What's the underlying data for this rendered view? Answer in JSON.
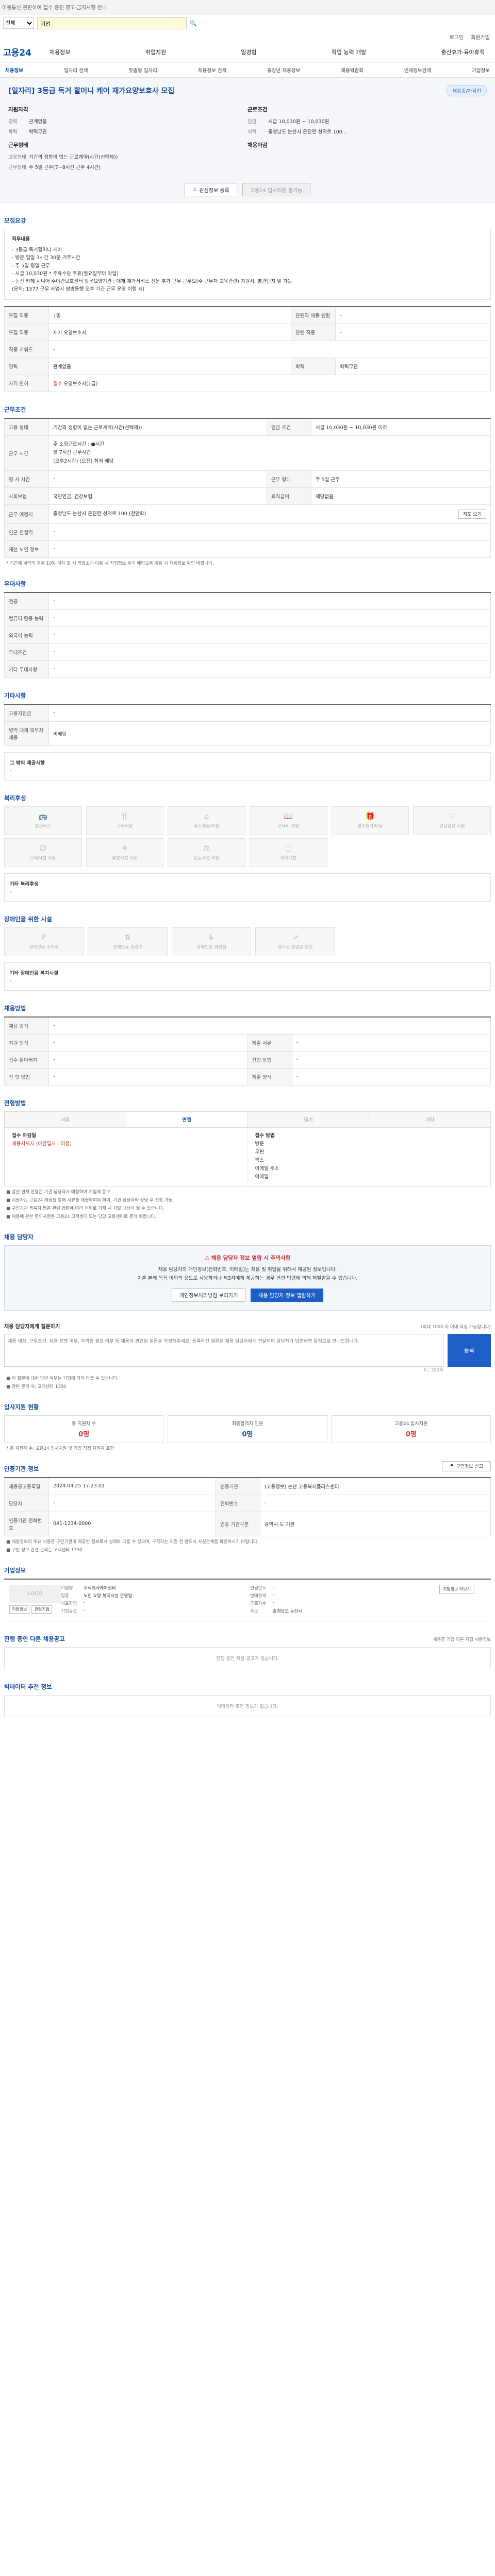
{
  "top": {
    "skip_text": "이동통신 관련하여 접수 중인 광고·금지사항 안내"
  },
  "search": {
    "category": "전체",
    "placeholder": "기업"
  },
  "util": [
    "로그인",
    "회원가입"
  ],
  "logo": "고용24",
  "gnb": [
    "채용정보",
    "취업지원",
    "일경험",
    "직업 능력 개발",
    "출산휴가·육아휴직"
  ],
  "subnav": [
    "채용정보",
    "일자리 검색",
    "맞춤형 일자리",
    "채용정보 검색",
    "중장년 채용정보",
    "채용박람회",
    "인재정보검색",
    "기업정보"
  ],
  "hero": {
    "title": "[일자리] 3등급 독거 할머니 케어 재가요양보호사 모집",
    "badge": "채용중/마감전",
    "company_head": "지원자격",
    "company_rows": [
      {
        "k": "경력",
        "v": "관계없음"
      },
      {
        "k": "학력",
        "v": "학력무관"
      }
    ],
    "cond_head": "근로조건",
    "cond_rows": [
      {
        "k": "임금",
        "v": "시급 10,030원 ~ 10,030원"
      },
      {
        "k": "지역",
        "v": "충청남도 논산시 은진면 성덕로 100..."
      }
    ],
    "place_head": "근무형태",
    "place_rows": [
      {
        "k": "고용형태",
        "v": "기간의 정함이 없는 근로계약(시간(선택제))"
      },
      {
        "k": "근무형태",
        "v": "주 5일 근무(7~8시간 근무 4시간)"
      }
    ],
    "intake_head": "채용마감",
    "btn_share": "관심정보 등록",
    "btn_apply": "고용24 입사지원 불가능"
  },
  "recruit": {
    "title": "모집요강",
    "desc_title": "직무내용",
    "desc_lines": [
      "- 3등급 독거할머니 케어",
      "- 방문 일일 3시간 30분 거주시간",
      "- 주 5일 평일 근무",
      "- 시급 10,030원 * 주휴수당 주휴(월요일부터 작업)",
      "- 논산 카페 시니어 주야간보호센터 방문요양기관 : 대개 재가서비스 전문 추가 근무 근무요(주 근무자 교육관련) 지원시, 별관단지 앞 가능",
      "  (문의: 1577 근무 사업시 쌍방통행 오후 기관 근무 운영 이행 시)"
    ],
    "rows": [
      {
        "k1": "모집 직종",
        "v1": "1명",
        "k2": "관련직 채용 인원",
        "v2": "-"
      },
      {
        "k1": "모집 직종",
        "v1": "재가 요양보호사",
        "k2": "관련 직종",
        "v2": "-"
      },
      {
        "k1": "직종 키워드",
        "v1": "-",
        "k2": "",
        "v2": ""
      },
      {
        "k1": "경력",
        "v1": "관계없음",
        "k2": "학력",
        "v2": "학력무관"
      },
      {
        "k1": "자격 면허",
        "v1": "필수",
        "v1b": "요양보호사(1급)",
        "k2": "",
        "v2": ""
      }
    ]
  },
  "workcond": {
    "title": "근무조건",
    "rows": [
      {
        "k1": "고용 형태",
        "v1": "기간의 정함이 없는 근로계약(시간(선택제))",
        "k2": "임금 조건",
        "v2": "시급 10,030원 ~ 10,030원 이하"
      },
      {
        "k1": "근무 시간",
        "v1": "주 소정근로시간 : ●시간\n평 7시간 근무시간\n(오후2시간) (오전) 최저 해당",
        "k2": "",
        "v2": ""
      },
      {
        "k1": "평 사 시간",
        "v1": "-",
        "k2": "근무 형태",
        "v2": "주 5일 근무"
      },
      {
        "k1": "사회보험",
        "v1": "국민연금, 건강보험",
        "k2": "퇴직급여",
        "v2": "해당없음"
      },
      {
        "k1": "근무 예정지",
        "v1": "충청남도 논산시 은진면 성덕로 100 (천안화)",
        "k2": "",
        "v2": ""
      },
      {
        "k1": "인근 전철역",
        "v1": "-",
        "k2": "",
        "v2": ""
      },
      {
        "k1": "재산 노인 정보",
        "v1": "-",
        "k2": "",
        "v2": ""
      }
    ],
    "map_btn": "지도 보기",
    "note": "* 기간제 계약의 경우 10일 이하 할 시 직업소개 이용 시 직업정보 주의 예방교육 이용 시 채용정보 확인 바랍니다."
  },
  "prefer": {
    "title": "우대사항",
    "rows": [
      {
        "k": "전공",
        "v": "-"
      },
      {
        "k": "컴퓨터 활용 능력",
        "v": "-"
      },
      {
        "k": "외국어 능력",
        "v": "-"
      },
      {
        "k": "우대조건",
        "v": "-"
      },
      {
        "k": "기타 우대사항",
        "v": "-"
      }
    ]
  },
  "etc": {
    "title": "기타사항",
    "rows": [
      {
        "k": "고용지원금",
        "v": "-"
      },
      {
        "k": "병역 대체 복무자 채용",
        "v": "비해당"
      }
    ],
    "other_title": "그 밖의 제공사항",
    "other_val": "-"
  },
  "welfare": {
    "title": "복리후생",
    "items": [
      {
        "icon": "car-icon",
        "label": "통근버스"
      },
      {
        "icon": "fork-icon",
        "label": "구내식당"
      },
      {
        "icon": "house-icon",
        "label": "숙소제공/지원"
      },
      {
        "icon": "book-icon",
        "label": "교육비 지원"
      },
      {
        "icon": "gift-icon",
        "label": "경조휴가/비용"
      },
      {
        "icon": "heart-icon",
        "label": "건강검진 지원"
      },
      {
        "icon": "baby-icon",
        "label": "보육시설 지원"
      },
      {
        "icon": "plane-icon",
        "label": "휴양시설 지원"
      },
      {
        "icon": "dumbbell-icon",
        "label": "운동시설 지원"
      },
      {
        "icon": "pc-icon",
        "label": "자기계발"
      }
    ],
    "other_title": "기타 복리후생",
    "other_val": "-"
  },
  "disabled": {
    "title": "장애인을 위한 시설",
    "items": [
      {
        "label": "장애인용 주차장"
      },
      {
        "label": "장애인용 승강기"
      },
      {
        "label": "장애인용 화장실"
      },
      {
        "label": "경사로·출입문 보완"
      }
    ],
    "other_title": "기타 장애인용 복지시설",
    "other_val": "-"
  },
  "process": {
    "title": "채용방법",
    "rows": [
      {
        "k1": "채용 방식",
        "v1": "-",
        "k2": "",
        "v2": ""
      },
      {
        "k1": "지원 형식",
        "v1": "-",
        "k2": "제출 서류",
        "v2": "-"
      },
      {
        "k1": "접수 할아버지",
        "v1": "-",
        "k2": "전형 방법",
        "v2": "-"
      },
      {
        "k1": "전 형 방법",
        "v1": "-",
        "k2": "제출 양식",
        "v2": "-"
      }
    ]
  },
  "progress": {
    "title": "전형방법",
    "tabs": [
      "서류",
      "면접",
      "필기",
      "기타"
    ],
    "active": 1,
    "cols": [
      {
        "t": "접수 마감일",
        "v": "채용시까지 (마감일자 : 미정)",
        "red": true
      },
      {
        "t": "접수 방법",
        "v": "방문\n우편\n팩스\n이메일 주소\n이메일"
      }
    ],
    "notes": [
      "■ 알선 연계 전형은 기관 담당자가 매칭하여 기업에 통보",
      "■ 지원자는 고용24 계정을 통해 서류를 제출하여야 하며, 기관 담당자와 상담 후 신청 가능",
      "■ 구인기관 등록자 등은 관련 법령에 따라 허위로 기재 시 처벌 대상이 될 수 있습니다.",
      "■ 채용에 관한 문의사항은 고용24 고객센터 또는 담당 고용센터로 문의 바랍니다."
    ]
  },
  "contact": {
    "title": "채용 담당자",
    "lead": "채용 담당자 정보 열람 시 주의사항",
    "lines": [
      "채용 담당자의 개인정보(전화번호, 이메일)는 채용 및 취업을 위해서 제공된 정보입니다.",
      "이를 본래 목적 이외의 용도로 사용하거나 제3자에게 제공하는 경우 관련 법령에 의해 처벌받을 수 있습니다."
    ],
    "btn_view": "개인정보처리방침 보러가기",
    "btn_show": "채용 담당자 정보 열람하기"
  },
  "question": {
    "title": "채용 담당자에게 질문하기",
    "counter": "0 / 200자",
    "hint": "(최대 1000 자 이내 작성 가능합니다)",
    "placeholder": "채용 대상, 근무조건, 채용 진행 여부, 자격증 필요 여부 등 채용과 관련된 질문을 작성해주세요. 등록하신 질문은 채용 담당자에게 전달되며 담당자가 답변하면 알림으로 안내드립니다.",
    "submit": "등록",
    "notes": [
      "■ 이 질문에 대한 답변 여부는 기업에 따라 다를 수 있습니다.",
      "■ 관련 문의 처: 고객센터 1350"
    ]
  },
  "applicant": {
    "title": "입사지원 현황",
    "items": [
      {
        "k": "총 지원자 수",
        "v": "0명",
        "red": true
      },
      {
        "k": "최종합격자 인원",
        "v": "0명"
      },
      {
        "k": "고용24 입사지원",
        "v": "0명",
        "red": true
      }
    ],
    "note": "* 총 지원자 수: 고용24 입사지원 및 기업 직접 지원자 포함"
  },
  "meta": {
    "title": "인증기관 정보",
    "btn_report": "구인정보 신고",
    "rows": [
      {
        "k1": "채용공고등록일",
        "v1": "2024.04.25 17:23:01",
        "k2": "인증기관",
        "v2": "(고용정보) 논산 고용복지플러스센터"
      },
      {
        "k1": "담당자",
        "v1": "-",
        "k2": "전화번호",
        "v2": "-"
      },
      {
        "k1": "인증기관 전화번호",
        "v1": "041-1234-0000",
        "k2": "인증 기관구분",
        "v2": "광역시·도 기관"
      }
    ],
    "notes": [
      "■ 채용정보의 주요 내용은 구인기관이 제공한 정보로서 실제와 다를 수 있으며, 구직자는 지원 전 반드시 사실관계를 확인하시기 바랍니다.",
      "■ 구인 정보 관련 문의는 고객센터 1350"
    ]
  },
  "enterprise": {
    "title": "기업정보",
    "logo": "LOGO",
    "btns": [
      "기업정보",
      "관심기업"
    ],
    "col1": [
      {
        "k": "기업명",
        "v": "주식회사케어센터"
      },
      {
        "k": "업종",
        "v": "노인 요양 복지시설 운영업"
      },
      {
        "k": "대표자명",
        "v": "-"
      },
      {
        "k": "기업규모",
        "v": "-"
      }
    ],
    "col2": [
      {
        "k": "설립년도",
        "v": "-"
      },
      {
        "k": "연매출액",
        "v": "-"
      },
      {
        "k": "근로자수",
        "v": "-"
      },
      {
        "k": "주소",
        "v": "충청남도 논산시"
      }
    ],
    "btn_more": "기업정보 더보기"
  },
  "other_jobs": {
    "title": "진행 중인 다른 채용공고",
    "hint": "채용중 기업 다른 지점 채용정보",
    "empty": "진행 중인 채용 공고가 없습니다."
  },
  "recommend": {
    "title": "빅데이터 추천 정보",
    "empty": "빅데이터 추천 정보가 없습니다."
  }
}
